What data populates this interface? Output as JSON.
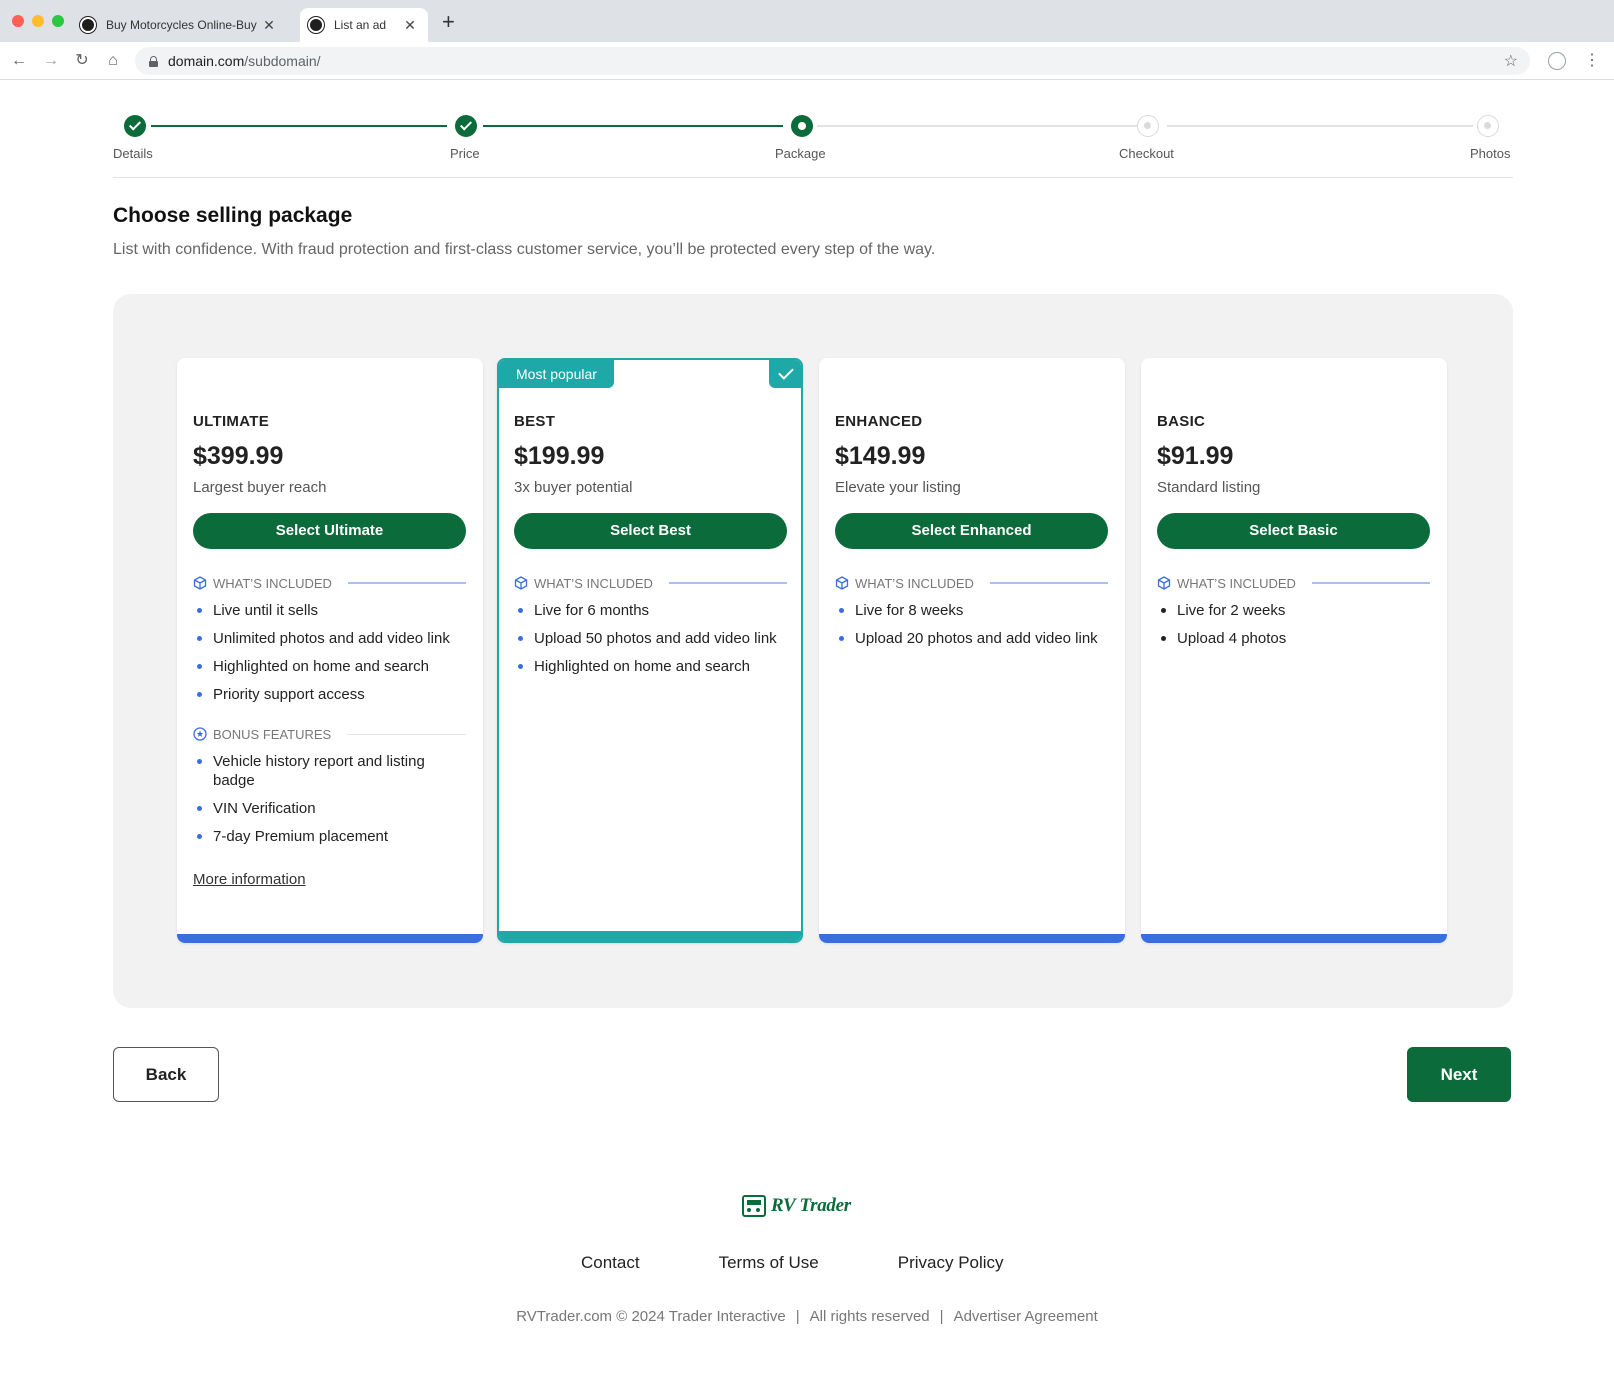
{
  "browser": {
    "tabs": [
      {
        "title": "Buy Motorcycles Online-Buy",
        "active": false
      },
      {
        "title": "List an ad",
        "active": true
      }
    ],
    "url_domain": "domain.com",
    "url_path": "/subdomain/"
  },
  "stepper": {
    "steps": [
      {
        "label": "Details",
        "state": "done"
      },
      {
        "label": "Price",
        "state": "done"
      },
      {
        "label": "Package",
        "state": "current"
      },
      {
        "label": "Checkout",
        "state": "todo"
      },
      {
        "label": "Photos",
        "state": "todo"
      }
    ]
  },
  "header": {
    "title": "Choose selling package",
    "subtitle": "List with confidence. With fraud protection and first-class customer service, you’ll be protected every step of the way."
  },
  "packages": [
    {
      "name": "ULTIMATE",
      "price": "$399.99",
      "description": "Largest buyer reach",
      "button": "Select Ultimate",
      "included_label": "WHAT’S INCLUDED",
      "included": [
        "Live until it sells",
        "Unlimited photos and add video link",
        "Highlighted on home and search",
        "Priority support access"
      ],
      "bonus_label": "BONUS FEATURES",
      "bonus": [
        "Vehicle history report and listing badge",
        "VIN Verification",
        "7-day Premium placement"
      ],
      "more_info": "More information"
    },
    {
      "name": "BEST",
      "price": "$199.99",
      "description": "3x buyer potential",
      "button": "Select Best",
      "badge": "Most popular",
      "selected": true,
      "included_label": "WHAT’S INCLUDED",
      "included": [
        "Live for 6 months",
        "Upload 50 photos and add video link",
        "Highlighted on home and search"
      ]
    },
    {
      "name": "ENHANCED",
      "price": "$149.99",
      "description": "Elevate your listing",
      "button": "Select Enhanced",
      "included_label": "WHAT’S INCLUDED",
      "included": [
        "Live for 8 weeks",
        "Upload 20 photos and add video link"
      ]
    },
    {
      "name": "BASIC",
      "price": "$91.99",
      "description": "Standard listing",
      "button": "Select Basic",
      "included_label": "WHAT’S INCLUDED",
      "included": [
        "Live for 2 weeks",
        "Upload 4 photos"
      ]
    }
  ],
  "nav": {
    "back": "Back",
    "next": "Next"
  },
  "footer": {
    "logo_text": "RV Trader",
    "links": [
      "Contact",
      "Terms of Use",
      "Privacy Policy"
    ],
    "copyright": "RVTrader.com © 2024 Trader Interactive",
    "rights": "All rights reserved",
    "agreement": "Advertiser Agreement"
  },
  "colors": {
    "brand_green": "#0b6b3a",
    "accent_blue": "#3a6ee0",
    "teal": "#1fa8a8"
  }
}
